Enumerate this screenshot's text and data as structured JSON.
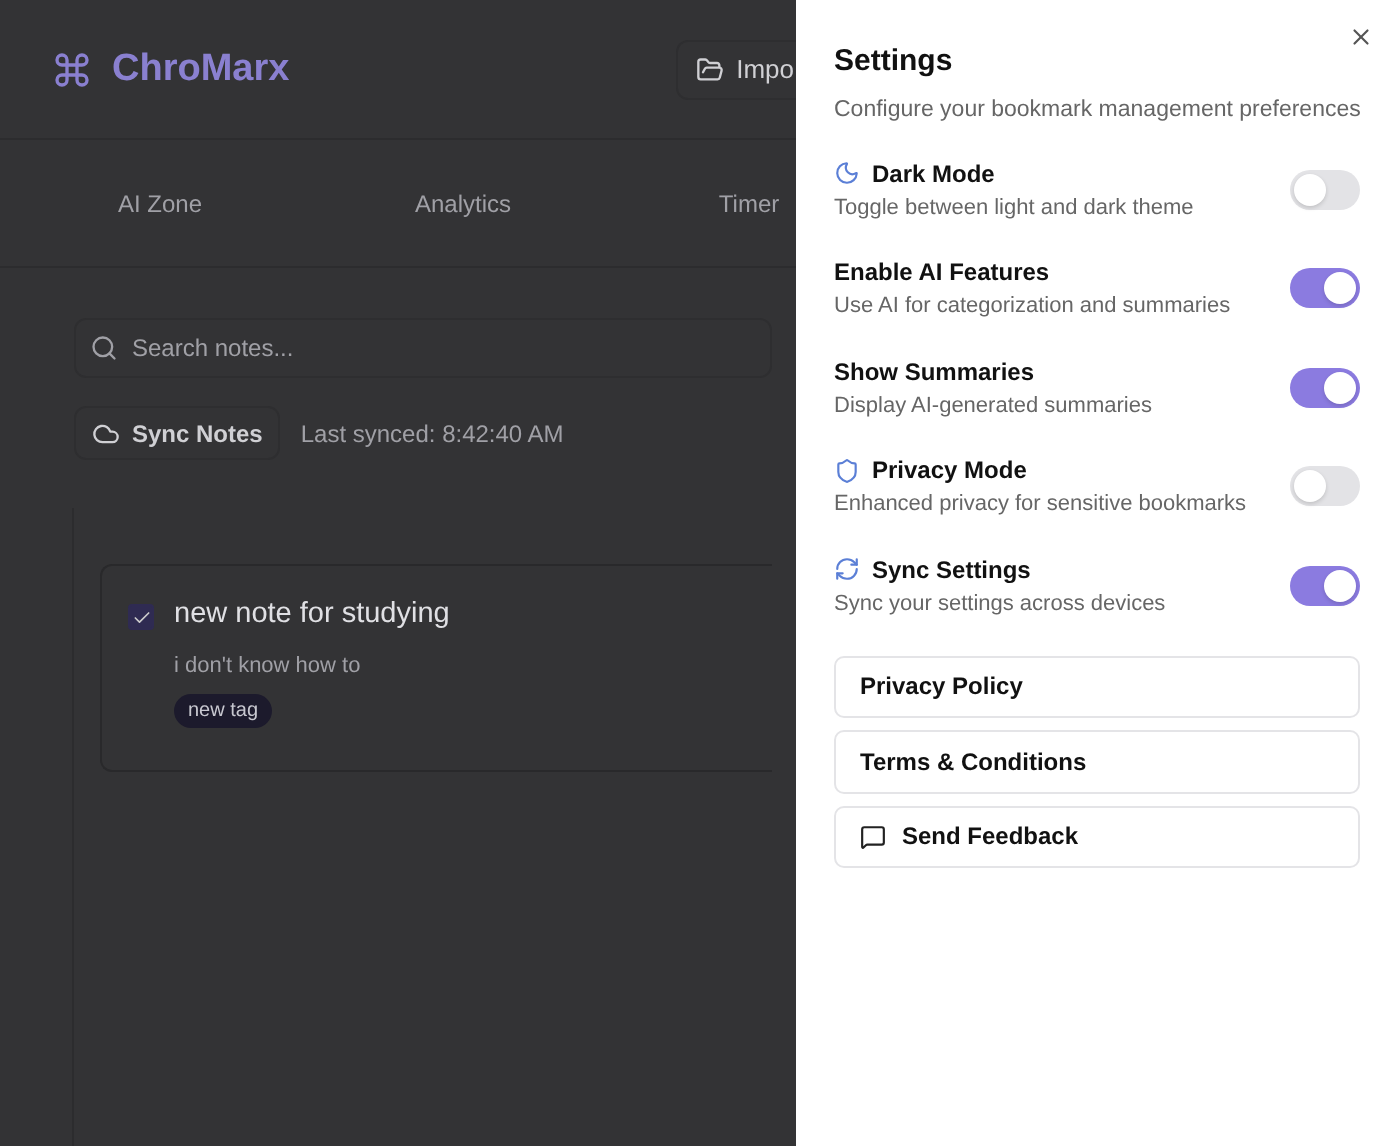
{
  "app": {
    "logo": "ChroMarx",
    "import_button": "Impo"
  },
  "tabs": [
    {
      "label": "AI Zone",
      "selected": false
    },
    {
      "label": "Analytics",
      "selected": false
    },
    {
      "label": "Timer",
      "selected": false
    }
  ],
  "search": {
    "placeholder": "Search notes..."
  },
  "sync": {
    "button": "Sync Notes",
    "last_synced": "Last synced: 8:42:40 AM"
  },
  "notes": [
    {
      "title": "new note for studying",
      "checked": true,
      "body": "i don't know how to",
      "tags": [
        "new tag"
      ]
    }
  ],
  "settings": {
    "title": "Settings",
    "subtitle": "Configure your bookmark management preferences",
    "items": [
      {
        "label": "Dark Mode",
        "description": "Toggle between light and dark theme",
        "on": false
      },
      {
        "label": "Enable AI Features",
        "description": "Use AI for categorization and summaries",
        "on": true
      },
      {
        "label": "Show Summaries",
        "description": "Display AI-generated summaries",
        "on": true
      },
      {
        "label": "Privacy Mode",
        "description": "Enhanced privacy for sensitive bookmarks",
        "on": false
      },
      {
        "label": "Sync Settings",
        "description": "Sync your settings across devices",
        "on": true
      }
    ],
    "links": [
      "Privacy Policy",
      "Terms & Conditions",
      "Send Feedback"
    ]
  }
}
